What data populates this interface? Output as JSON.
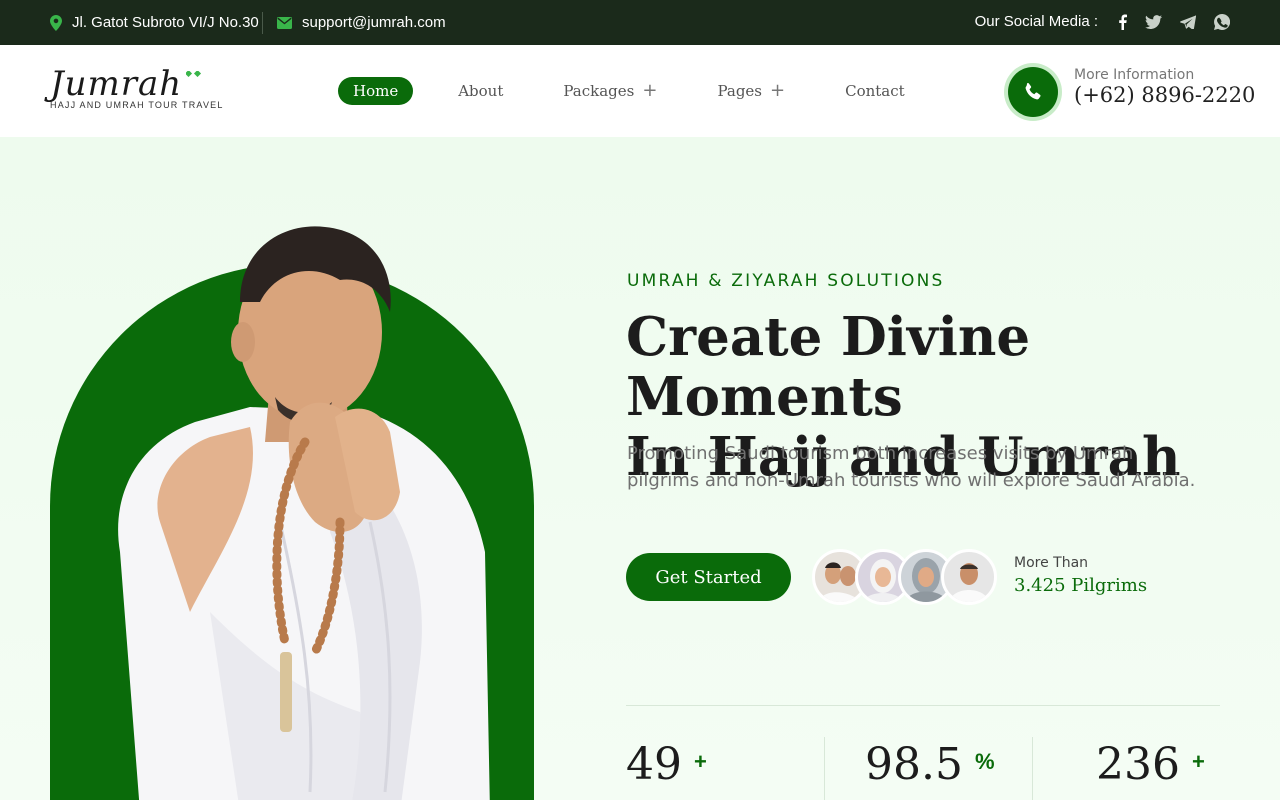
{
  "topbar": {
    "address": "Jl. Gatot Subroto VI/J No.30",
    "email": "support@jumrah.com",
    "social_label": "Our Social Media :",
    "social_icons": [
      "facebook-icon",
      "twitter-icon",
      "telegram-icon",
      "whatsapp-icon"
    ]
  },
  "brand": {
    "name": "Jumrah",
    "tagline": "HAJJ AND UMRAH TOUR TRAVEL"
  },
  "nav": {
    "items": [
      {
        "label": "Home",
        "active": true,
        "has_submenu": false
      },
      {
        "label": "About",
        "active": false,
        "has_submenu": false
      },
      {
        "label": "Packages",
        "active": false,
        "has_submenu": true
      },
      {
        "label": "Pages",
        "active": false,
        "has_submenu": true
      },
      {
        "label": "Contact",
        "active": false,
        "has_submenu": false
      }
    ],
    "plus_symbol": "+"
  },
  "contact": {
    "label": "More Information",
    "phone": "(+62) 8896-2220"
  },
  "hero": {
    "eyebrow": "UMRAH & ZIYARAH SOLUTIONS",
    "title_line1": "Create Divine Moments",
    "title_line2": "In Hajj and Umrah",
    "lead": "Promoting Saudi tourism both increases visits by Umrah pilgrims and non-Umrah tourists who will explore Saudi Arabia.",
    "cta_label": "Get Started",
    "pilgrims_label": "More Than",
    "pilgrims_value": "3.425 Pilgrims"
  },
  "stats": [
    {
      "value": "49",
      "suffix": "+"
    },
    {
      "value": "98.5",
      "suffix": "%"
    },
    {
      "value": "236",
      "suffix": "+"
    }
  ],
  "colors": {
    "brand_green": "#0a6b0a",
    "topbar_bg": "#1b2a1b",
    "hero_bg": "#eefbee"
  }
}
